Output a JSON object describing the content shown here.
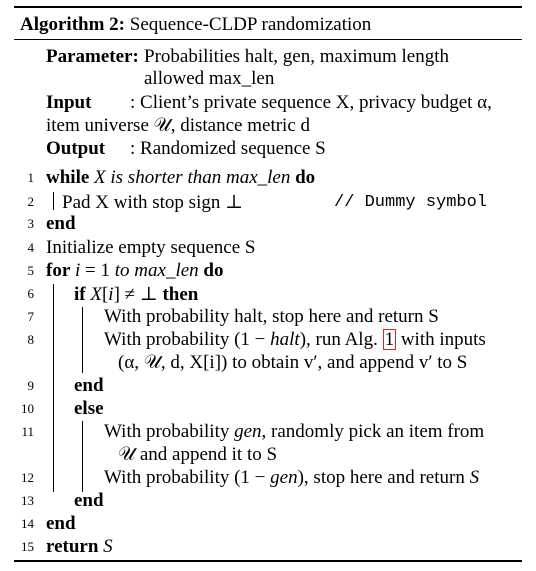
{
  "algorithm": {
    "label": "Algorithm 2:",
    "title": "Sequence-CLDP randomization"
  },
  "parameter": {
    "label": "Parameter:",
    "line1": "Probabilities halt, gen, maximum length",
    "line2": "allowed max_len"
  },
  "input": {
    "label": "Input",
    "line1": ": Client’s private sequence X, privacy budget α,",
    "line2": "item universe 𝒰, distance metric d"
  },
  "output": {
    "label": "Output",
    "line1": ": Randomized sequence S"
  },
  "lines": [
    {
      "num": "1",
      "text": "while X is shorter than max_len do"
    },
    {
      "num": "2",
      "text": "Pad X with stop sign ⊥",
      "comment": "// Dummy symbol"
    },
    {
      "num": "3",
      "text": "end"
    },
    {
      "num": "4",
      "text": "Initialize empty sequence S"
    },
    {
      "num": "5",
      "text": "for i = 1 to max_len do"
    },
    {
      "num": "6",
      "text": "if X[i] ≠ ⊥ then"
    },
    {
      "num": "7",
      "text": "With probability halt, stop here and return S"
    },
    {
      "num": "8",
      "text": "With probability (1 − halt), run Alg. 1 with inputs",
      "cont": "(α, 𝒰, d, X[i]) to obtain v′, and append v′ to S",
      "ref": "1"
    },
    {
      "num": "9",
      "text": "end"
    },
    {
      "num": "10",
      "text": "else"
    },
    {
      "num": "11",
      "text": "With probability gen, randomly pick an item from",
      "cont": "𝒰 and append it to S"
    },
    {
      "num": "12",
      "text": "With probability (1 − gen), stop here and return S"
    },
    {
      "num": "13",
      "text": "end"
    },
    {
      "num": "14",
      "text": "end"
    },
    {
      "num": "15",
      "text": "return S"
    }
  ],
  "colors": {
    "reference_box": "#e8231f",
    "text": "#000000"
  }
}
